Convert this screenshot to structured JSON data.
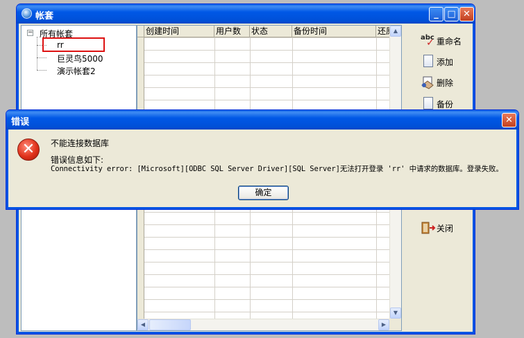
{
  "main_window": {
    "title": "帐套",
    "tree": {
      "root_label": "所有帐套",
      "items": [
        "rr",
        "巨灵鸟5000",
        "演示帐套2"
      ]
    },
    "grid": {
      "columns": [
        "创建时间",
        "用户数",
        "状态",
        "备份时间",
        "还原"
      ]
    },
    "actions": [
      {
        "label": "重命名",
        "icon": "rename-icon"
      },
      {
        "label": "添加",
        "icon": "document-icon"
      },
      {
        "label": "删除",
        "icon": "delete-icon"
      },
      {
        "label": "备份",
        "icon": "document-icon"
      },
      {
        "label": "关闭",
        "icon": "close-door-icon"
      }
    ]
  },
  "error_dialog": {
    "title": "错误",
    "message": "不能连接数据库",
    "detail_label": "错误信息如下:",
    "detail_text": "Connectivity error: [Microsoft][ODBC SQL Server Driver][SQL Server]无法打开登录 'rr' 中请求的数据库。登录失败。",
    "ok_label": "确定"
  },
  "colors": {
    "titlebar_blue": "#0058e6",
    "highlight_red": "#d11111",
    "error_red": "#e0321b"
  }
}
